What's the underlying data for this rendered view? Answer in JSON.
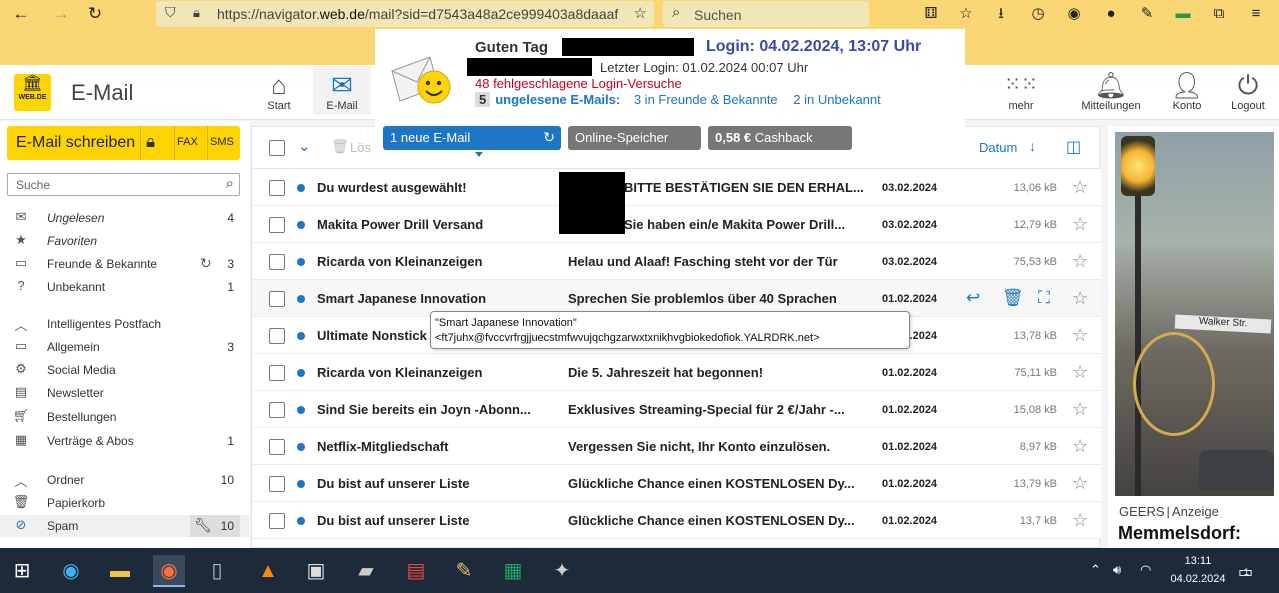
{
  "browser": {
    "url_prefix": "https://navigator.",
    "url_domain": "web.de",
    "url_rest": "/mail?sid=d7543a48a2ce999403a8daaaf",
    "search_placeholder": "Suchen"
  },
  "app": {
    "logo_text": "WEB.DE",
    "title": "E-Mail",
    "nav": {
      "start": "Start",
      "email": "E-Mail",
      "more": "mehr",
      "notifications": "Mitteilungen",
      "account": "Konto",
      "logout": "Logout"
    }
  },
  "popup": {
    "greeting": "Guten Tag",
    "login_info": "Login: 04.02.2024, 13:07 Uhr",
    "last_login": "Letzter Login: 01.02.2024 00:07 Uhr",
    "failed_logins": "48 fehlgeschlagene Login-Versuche",
    "unread_count": "5",
    "unread_label": "ungelesene E-Mails:",
    "friends_unread": "3 in Freunde & Bekannte",
    "unknown_unread": "2 in Unbekannt",
    "tab_new_mail": "1 neue E-Mail",
    "tab_storage": "Online-Speicher",
    "tab_cashback_amount": "0,58 €",
    "tab_cashback_label": "Cashback"
  },
  "sidebar": {
    "compose_label": "E-Mail schreiben",
    "fax_label": "FAX",
    "sms_label": "SMS",
    "search_placeholder": "Suche",
    "folders": [
      {
        "label": "Ungelesen",
        "count": "4",
        "icon": "envelope-stack-icon"
      },
      {
        "label": "Favoriten",
        "count": "",
        "icon": "star-icon"
      },
      {
        "label": "Freunde & Bekannte",
        "count": "3",
        "icon": "inbox-icon"
      },
      {
        "label": "Unbekannt",
        "count": "1",
        "icon": "question-icon"
      }
    ],
    "smart_header": "Intelligentes Postfach",
    "smart_folders": [
      {
        "label": "Allgemein",
        "count": "3",
        "icon": "inbox-icon"
      },
      {
        "label": "Social Media",
        "count": "",
        "icon": "social-icon"
      },
      {
        "label": "Newsletter",
        "count": "",
        "icon": "newsletter-icon"
      },
      {
        "label": "Bestellungen",
        "count": "",
        "icon": "cart-icon"
      },
      {
        "label": "Verträge & Abos",
        "count": "1",
        "icon": "contract-icon"
      }
    ],
    "ordner_header": "Ordner",
    "ordner_count": "10",
    "ordner_items": [
      {
        "label": "Papierkorb",
        "count": "",
        "icon": "trash-icon"
      },
      {
        "label": "Spam",
        "count": "10",
        "icon": "spam-icon"
      }
    ]
  },
  "list": {
    "delete_label": "Lös",
    "sort_label": "Datum",
    "rows": [
      {
        "sender": "Du wurdest ausgewählt!",
        "subject": "BITTE BESTÄTIGEN SIE DEN ERHAL...",
        "date": "03.02.2024",
        "size": "13,06 kB"
      },
      {
        "sender": "Makita Power Drill Versand",
        "subject": "Sie haben ein/e Makita Power Drill...",
        "date": "03.02.2024",
        "size": "12,79 kB"
      },
      {
        "sender": "Ricarda von Kleinanzeigen",
        "subject": "Helau und Alaaf! Fasching steht vor der Tür",
        "date": "03.02.2024",
        "size": "75,53 kB"
      },
      {
        "sender": "Smart Japanese Innovation",
        "subject": "Sprechen Sie problemlos über 40 Sprachen",
        "date": "01.02.2024",
        "size": ""
      },
      {
        "sender": "Ultimate Nonstick",
        "subject": "",
        "date": "01.02.2024",
        "size": "13,78 kB"
      },
      {
        "sender": "Ricarda von Kleinanzeigen",
        "subject": "Die 5. Jahreszeit hat begonnen!",
        "date": "01.02.2024",
        "size": "75,11 kB"
      },
      {
        "sender": "Sind Sie bereits ein Joyn -Abonn...",
        "subject": "Exklusives Streaming-Special für 2 €/Jahr -...",
        "date": "01.02.2024",
        "size": "15,08 kB"
      },
      {
        "sender": "Netflix-Mitgliedschaft",
        "subject": "Vergessen Sie nicht, Ihr Konto einzulösen.",
        "date": "01.02.2024",
        "size": "8,97 kB"
      },
      {
        "sender": "Du bist auf unserer Liste",
        "subject": "Glückliche Chance einen KOSTENLOSEN Dy...",
        "date": "01.02.2024",
        "size": "13,79 kB"
      },
      {
        "sender": "Du bist auf unserer Liste",
        "subject": "Glückliche Chance einen KOSTENLOSEN Dy...",
        "date": "01.02.2024",
        "size": "13,7 kB"
      }
    ]
  },
  "tooltip": {
    "line1": "\"Smart Japanese Innovation\"",
    "line2": "<ft7juhx@fvccvrfrgjjuecstmfwvujqchgzarwxtxnikhvgbiokedofiok.YALRDRK.net>"
  },
  "ad": {
    "sign_text": "Walker Str.",
    "label_brand": "GEERS",
    "label_sep": "|",
    "label_ad": "Anzeige",
    "title": "Memmelsdorf:"
  },
  "taskbar": {
    "time": "13:11",
    "date": "04.02.2024",
    "notifications": "1"
  },
  "colors": {
    "brand_yellow": "#ffd400",
    "browser_yellow": "#fbd674",
    "accent_blue": "#1c76c5",
    "error_red": "#c4001e"
  }
}
